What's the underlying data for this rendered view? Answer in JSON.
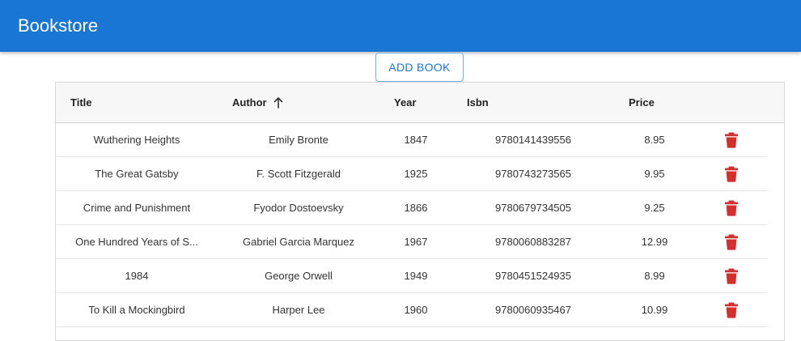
{
  "app": {
    "title": "Bookstore"
  },
  "toolbar": {
    "add_label": "ADD BOOK"
  },
  "table": {
    "columns": [
      "Title",
      "Author",
      "Year",
      "Isbn",
      "Price"
    ],
    "sort": {
      "column": "Author",
      "direction": "ascending"
    },
    "rows": [
      {
        "title": "Wuthering Heights",
        "author": "Emily Bronte",
        "year": "1847",
        "isbn": "9780141439556",
        "price": "8.95"
      },
      {
        "title": "The Great Gatsby",
        "author": "F. Scott Fitzgerald",
        "year": "1925",
        "isbn": "9780743273565",
        "price": "9.95"
      },
      {
        "title": "Crime and Punishment",
        "author": "Fyodor Dostoevsky",
        "year": "1866",
        "isbn": "9780679734505",
        "price": "9.25"
      },
      {
        "title": "One Hundred Years of S...",
        "author": "Gabriel Garcia Marquez",
        "year": "1967",
        "isbn": "9780060883287",
        "price": "12.99"
      },
      {
        "title": "1984",
        "author": "George Orwell",
        "year": "1949",
        "isbn": "9780451524935",
        "price": "8.99"
      },
      {
        "title": "To Kill a Mockingbird",
        "author": "Harper Lee",
        "year": "1960",
        "isbn": "9780060935467",
        "price": "10.99"
      }
    ]
  },
  "icons": {
    "sort": "arrow-up-icon",
    "delete": "trash-icon"
  },
  "colors": {
    "primary": "#1976d2",
    "delete": "#d32f2f",
    "header_bg": "#f7f7f7"
  }
}
